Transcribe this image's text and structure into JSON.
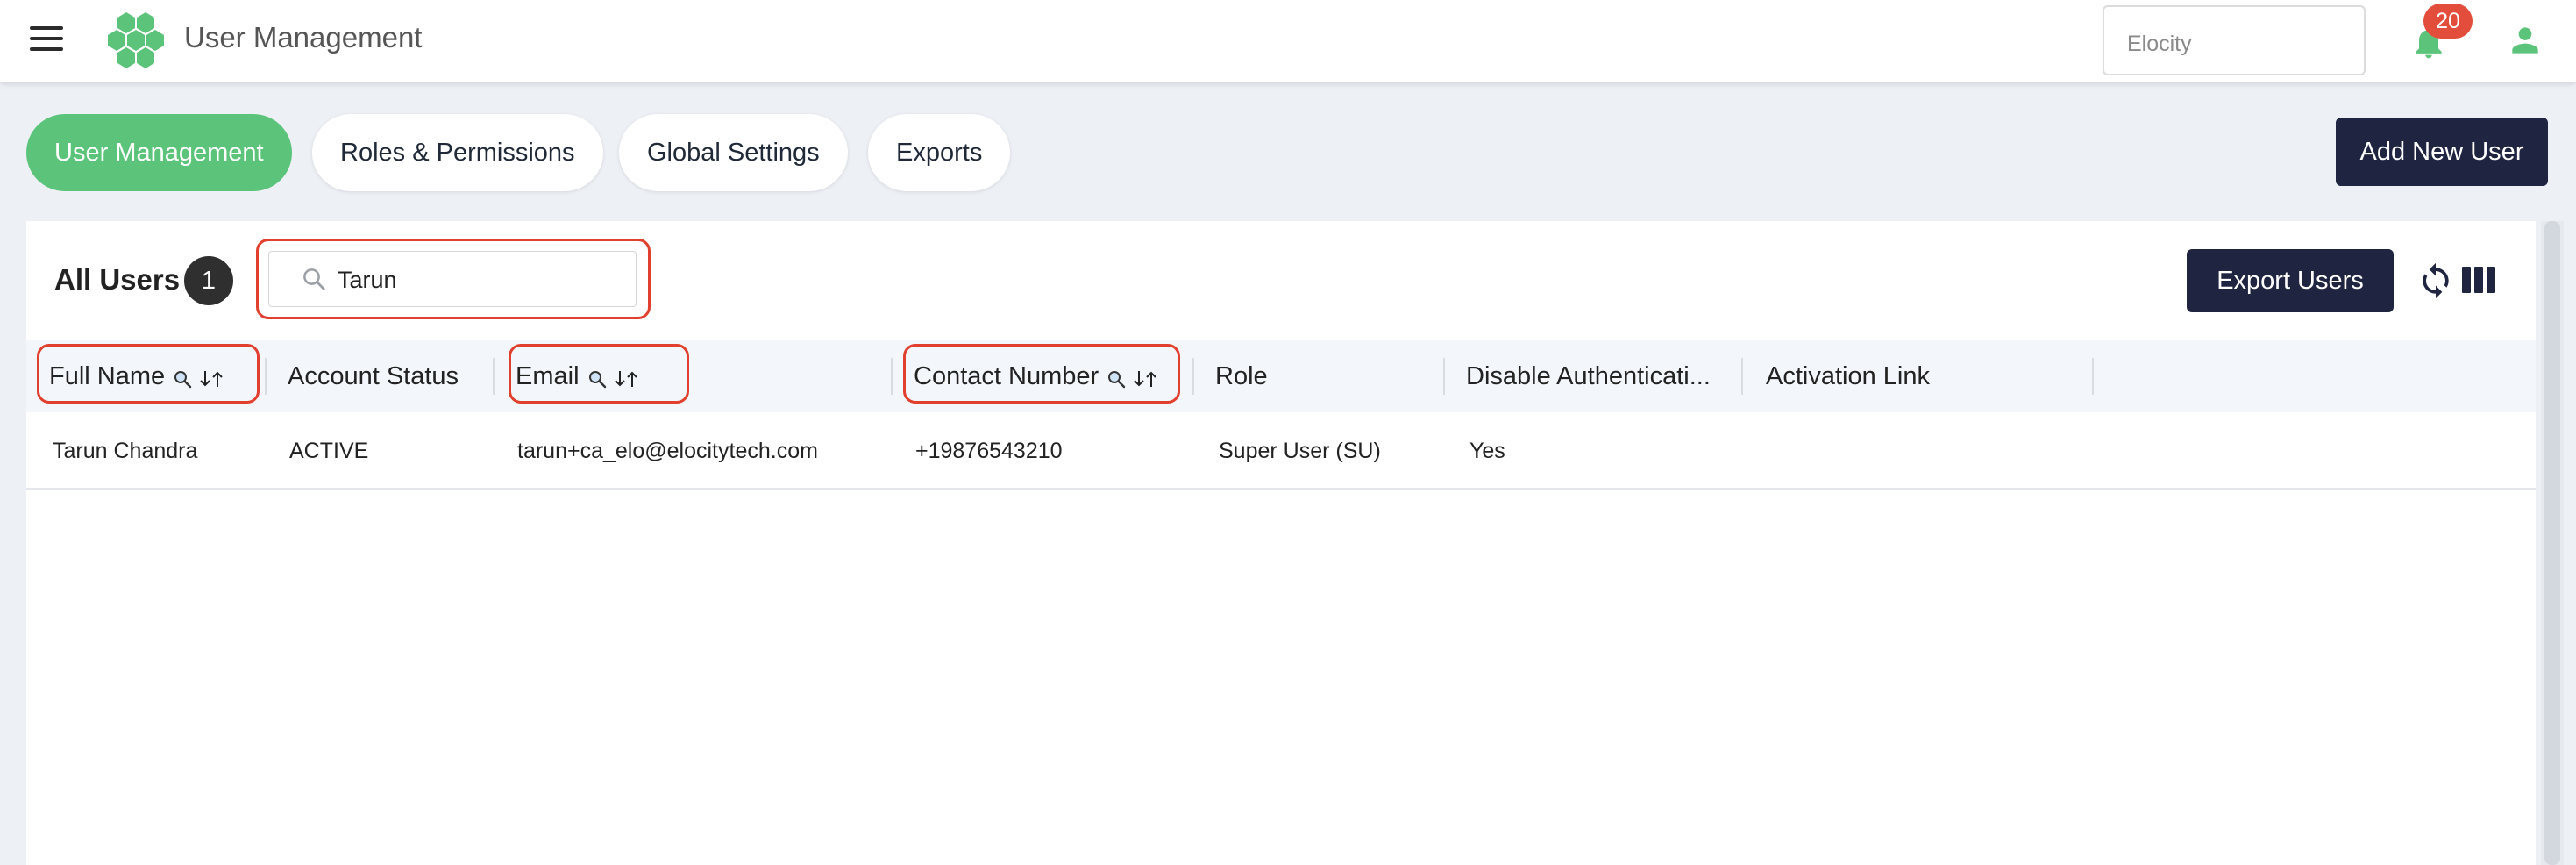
{
  "header": {
    "app_title": "User Management",
    "org_select": "Elocity",
    "notification_count": "20",
    "brand_color": "#5cc47a"
  },
  "tabs": [
    {
      "label": "User Management",
      "active": true
    },
    {
      "label": "Roles & Permissions",
      "active": false
    },
    {
      "label": "Global Settings",
      "active": false
    },
    {
      "label": "Exports",
      "active": false
    }
  ],
  "actions": {
    "add_user": "Add New User",
    "export_users": "Export Users"
  },
  "list": {
    "title": "All Users",
    "count": "1",
    "search_value": "Tarun"
  },
  "table": {
    "columns": [
      "Full Name",
      "Account Status",
      "Email",
      "Contact Number",
      "Role",
      "Disable Authenticati...",
      "Activation Link"
    ],
    "rows": [
      {
        "full_name": "Tarun Chandra",
        "account_status": "ACTIVE",
        "email": "tarun+ca_elo@elocitytech.com",
        "contact_number": "+19876543210",
        "role": "Super User (SU)",
        "disable_auth": "Yes",
        "activation_link": ""
      }
    ]
  },
  "icons": {
    "menu": "hamburger-menu-icon",
    "notifications": "bell-icon",
    "profile": "user-icon",
    "search": "search-icon",
    "refresh": "refresh-icon",
    "columns": "columns-icon",
    "sort": "sort-icon"
  }
}
